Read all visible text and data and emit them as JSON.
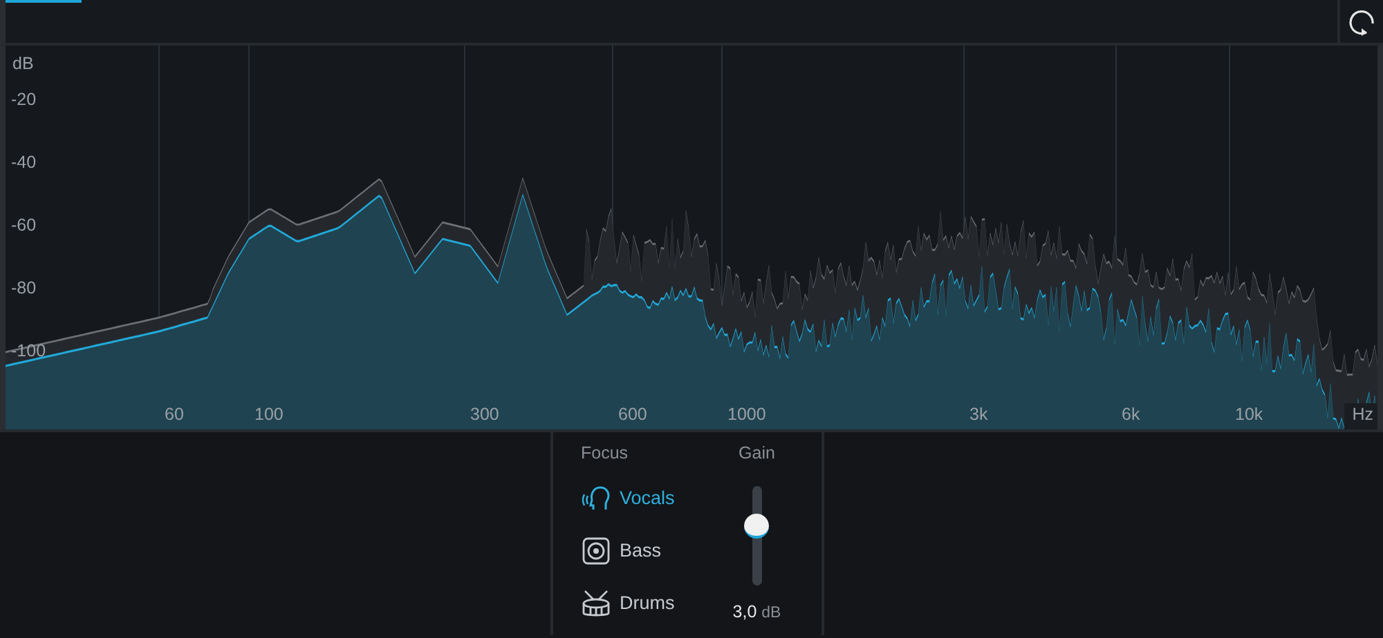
{
  "plot": {
    "y_unit": "dB",
    "y_labels": [
      "-20",
      "-40",
      "-60",
      "-80",
      "-100"
    ],
    "x_labels": [
      "60",
      "100",
      "300",
      "600",
      "1000",
      "3k",
      "6k",
      "10k"
    ],
    "x_unit": "Hz"
  },
  "focus": {
    "title": "Focus",
    "items": [
      {
        "kind": "vocals",
        "label": "Vocals",
        "selected": true
      },
      {
        "kind": "bass",
        "label": "Bass",
        "selected": false
      },
      {
        "kind": "drums",
        "label": "Drums",
        "selected": false
      }
    ]
  },
  "gain": {
    "title": "Gain",
    "level": 0.6,
    "value": "3,0",
    "unit": "dB"
  }
}
